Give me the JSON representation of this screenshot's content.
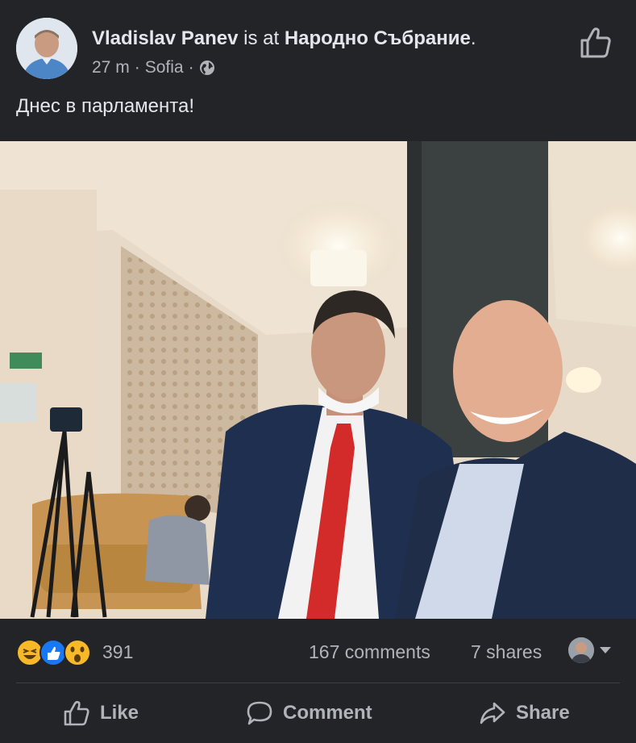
{
  "post": {
    "author": "Vladislav Panev",
    "is_at": "is at",
    "location": "Народно Събрание",
    "location_period": ".",
    "time": "27 m",
    "sep1": "·",
    "city": "Sofia",
    "sep2": "·",
    "privacy_icon": "globe-icon",
    "text": "Днес в парламента!"
  },
  "stats": {
    "reaction_icons": [
      "haha-icon",
      "like-icon",
      "wow-icon"
    ],
    "reactions_count": "391",
    "comments": "167 comments",
    "shares": "7 shares"
  },
  "actions": {
    "like": "Like",
    "comment": "Comment",
    "share": "Share"
  },
  "colors": {
    "background": "#232427",
    "text_primary": "#e4e6eb",
    "text_secondary": "#b0b3b8",
    "like_blue": "#1877f2",
    "reaction_yellow": "#f7b928"
  }
}
